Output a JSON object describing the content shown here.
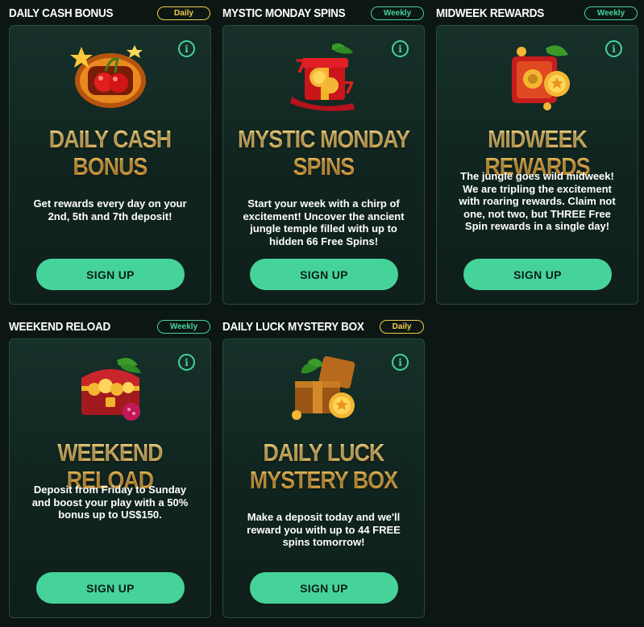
{
  "promotions": [
    {
      "title": "DAILY CASH BONUS",
      "badge": "Daily",
      "heading_line1": "DAILY CASH",
      "heading_line2": "BONUS",
      "description": "Get rewards every day on your 2nd, 5th and 7th deposit!",
      "button": "SIGN UP",
      "icon": "slot-cherries-icon"
    },
    {
      "title": "MYSTIC MONDAY SPINS",
      "badge": "Weekly",
      "heading_line1": "MYSTIC MONDAY",
      "heading_line2": "SPINS",
      "description": "Start your week with a chirp of excitement! Uncover the ancient jungle temple filled with up to hidden 66 Free Spins!",
      "button": "SIGN UP",
      "icon": "gift-coins-icon"
    },
    {
      "title": "MIDWEEK REWARDS",
      "badge": "Weekly",
      "heading_line1": "MIDWEEK REWARDS",
      "heading_line2": "",
      "description": "The jungle goes wild midweek! We are tripling the excitement with roaring rewards. Claim not one, not two, but THREE Free Spin rewards in a single day!",
      "button": "SIGN UP",
      "icon": "safe-coin-icon"
    },
    {
      "title": "WEEKEND RELOAD",
      "badge": "Weekly",
      "heading_line1": "WEEKEND RELOAD",
      "heading_line2": "",
      "description": "Deposit from Friday to Sunday and boost your play with a 50% bonus up to US$150.",
      "button": "SIGN UP",
      "icon": "treasure-chest-icon"
    },
    {
      "title": "DAILY LUCK MYSTERY BOX",
      "badge": "Daily",
      "heading_line1": "DAILY LUCK",
      "heading_line2": "MYSTERY BOX",
      "description": "Make a deposit today and we'll reward you with up to 44 FREE spins tomorrow!",
      "button": "SIGN UP",
      "icon": "mystery-box-icon"
    }
  ],
  "colors": {
    "background": "#0c1714",
    "accent_green": "#46d39a",
    "badge_daily": "#f2c94c",
    "heading_gold": "#f5c15a"
  }
}
